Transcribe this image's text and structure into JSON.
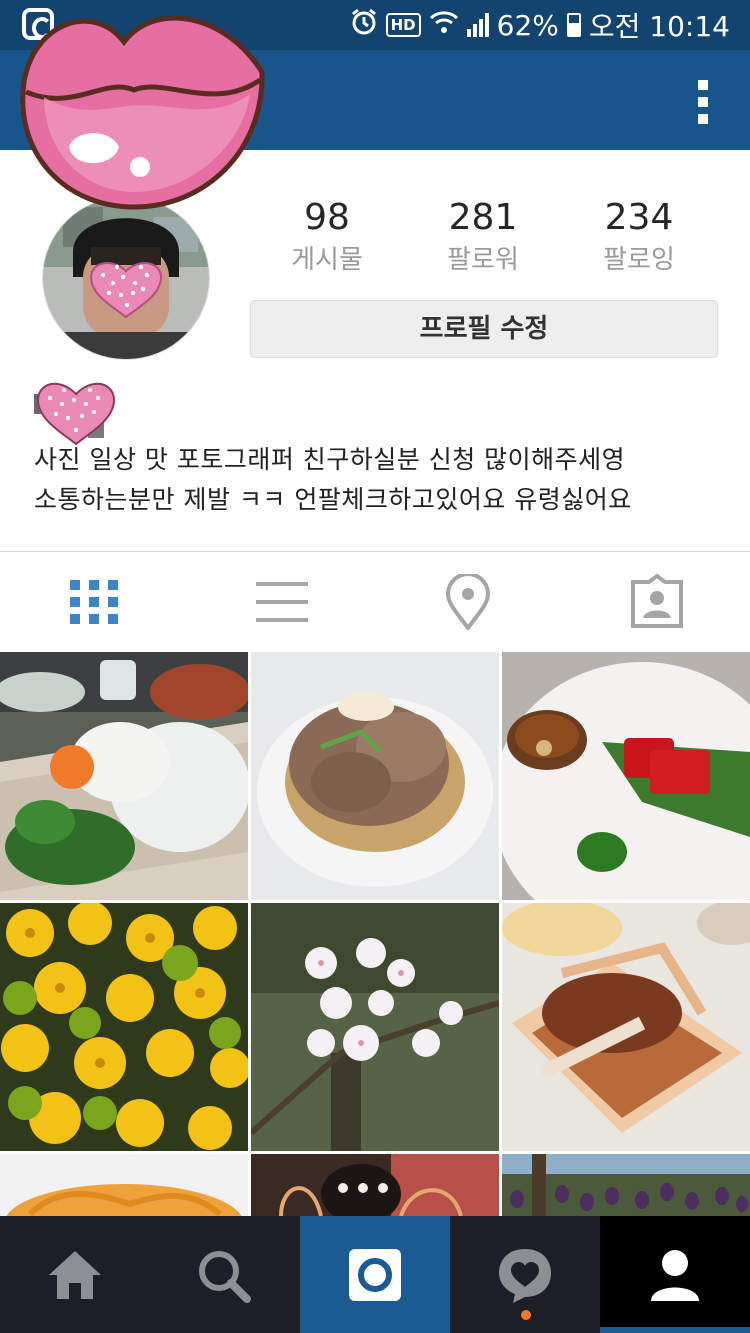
{
  "status_bar": {
    "battery": "62%",
    "time": "오전 10:14",
    "hd": "HD"
  },
  "profile": {
    "stats": [
      {
        "count": "98",
        "label": "게시물"
      },
      {
        "count": "281",
        "label": "팔로워"
      },
      {
        "count": "234",
        "label": "팔로잉"
      }
    ],
    "edit_button": "프로필 수정",
    "bio_lines": [
      "사진 일상 맛 포토그래퍼 친구하실분 신청 많이해주세영",
      "소통하는분만  제발  ㅋㅋ 언팔체크하고있어요  유령싫어요"
    ]
  },
  "view_tabs": [
    {
      "icon": "grid-icon",
      "active": true
    },
    {
      "icon": "list-icon",
      "active": false
    },
    {
      "icon": "location-pin-icon",
      "active": false
    },
    {
      "icon": "tagged-photos-icon",
      "active": false
    }
  ],
  "grid_photos": [
    "food-platter",
    "braised-beef",
    "tuna-sashimi",
    "yellow-flowers",
    "cherry-blossoms",
    "dish-bonito",
    "noodles",
    "illustration",
    "purple-tulips"
  ],
  "bottom_nav": [
    {
      "icon": "home-icon",
      "active": false
    },
    {
      "icon": "search-icon",
      "active": false
    },
    {
      "icon": "camera-icon",
      "active": false
    },
    {
      "icon": "activity-heart-icon",
      "active": false,
      "has_notification": true
    },
    {
      "icon": "profile-icon",
      "active": true
    }
  ],
  "colors": {
    "status_bar": "#12446f",
    "app_bar": "#18558a",
    "accent_blue": "#3a86c8",
    "bottom_nav": "#1c2026",
    "notification": "#f07a25"
  }
}
